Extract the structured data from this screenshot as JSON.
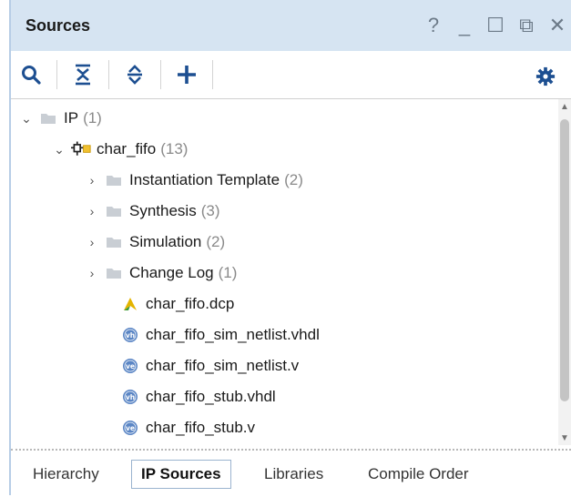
{
  "panel": {
    "title": "Sources"
  },
  "title_controls": {
    "help": "?",
    "minimize": "_",
    "maximize": "☐",
    "float": "⧉",
    "close": "✕"
  },
  "toolbar": {
    "icons": [
      "search-icon",
      "collapse-all-icon",
      "expand-all-icon",
      "add-icon",
      "gear-icon"
    ]
  },
  "tree": [
    {
      "label": "IP",
      "count": "(1)",
      "icon": "folder-icon",
      "expander": "expanded"
    },
    {
      "label": "char_fifo",
      "count": "(13)",
      "icon": "ip-core-icon",
      "expander": "expanded"
    },
    {
      "label": "Instantiation Template",
      "count": "(2)",
      "icon": "folder-icon",
      "expander": "collapsed"
    },
    {
      "label": "Synthesis",
      "count": "(3)",
      "icon": "folder-icon",
      "expander": "collapsed"
    },
    {
      "label": "Simulation",
      "count": "(2)",
      "icon": "folder-icon",
      "expander": "collapsed"
    },
    {
      "label": "Change Log",
      "count": "(1)",
      "icon": "folder-icon",
      "expander": "collapsed"
    },
    {
      "label": "char_fifo.dcp",
      "count": "",
      "icon": "dcp-file-icon",
      "expander": "none"
    },
    {
      "label": "char_fifo_sim_netlist.vhdl",
      "count": "",
      "icon": "vhdl-file-icon",
      "expander": "none"
    },
    {
      "label": "char_fifo_sim_netlist.v",
      "count": "",
      "icon": "verilog-file-icon",
      "expander": "none"
    },
    {
      "label": "char_fifo_stub.vhdl",
      "count": "",
      "icon": "vhdl-file-icon",
      "expander": "none"
    },
    {
      "label": "char_fifo_stub.v",
      "count": "",
      "icon": "verilog-file-icon",
      "expander": "none"
    }
  ],
  "tabs": [
    {
      "label": "Hierarchy",
      "active": false
    },
    {
      "label": "IP Sources",
      "active": true
    },
    {
      "label": "Libraries",
      "active": false
    },
    {
      "label": "Compile Order",
      "active": false
    }
  ],
  "colors": {
    "header_bg": "#d6e4f2",
    "accent_blue": "#1d4f91",
    "folder": "#c9ced4",
    "dcp_yellow": "#e4b400"
  }
}
